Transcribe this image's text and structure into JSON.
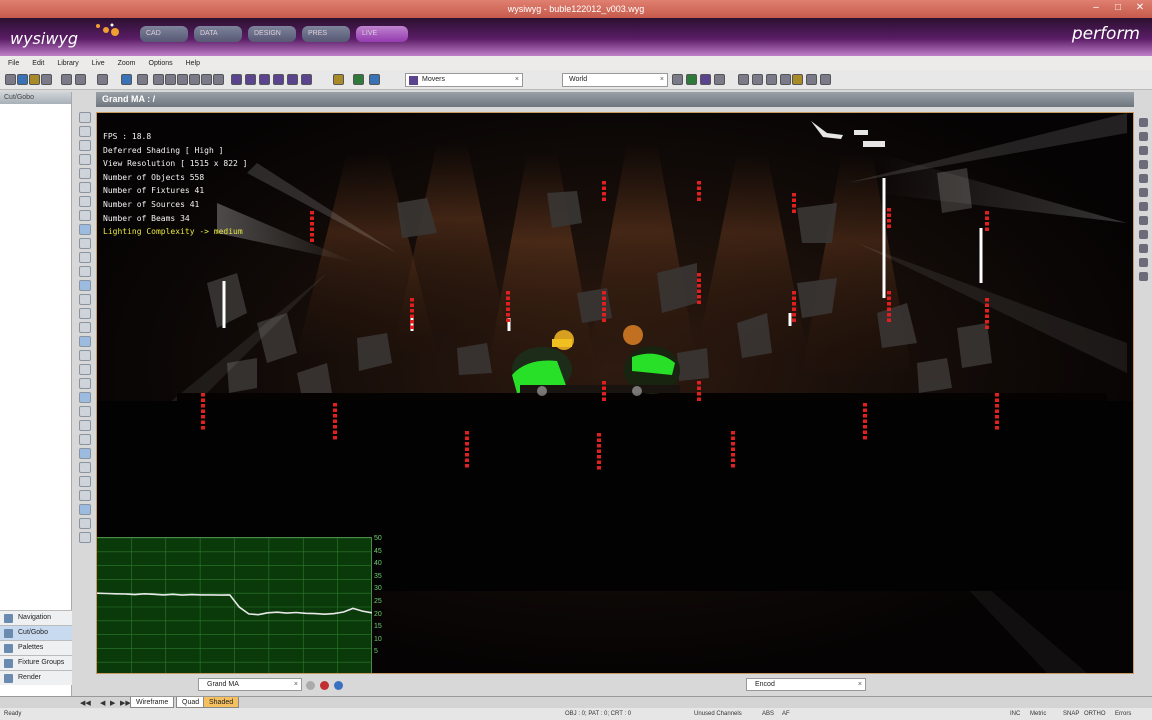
{
  "window": {
    "title": "wysiwyg - buble122012_v003.wyg"
  },
  "banner": {
    "logo": "wysiwyg",
    "mode": "perform",
    "mode_tabs": [
      "CAD",
      "DATA",
      "DESIGN",
      "PRES",
      "LIVE"
    ]
  },
  "menu": [
    "File",
    "Edit",
    "Library",
    "Live",
    "Zoom",
    "Options",
    "Help"
  ],
  "toolbar": {
    "library_combo": "Movers",
    "view_combo": "World"
  },
  "left_panel": {
    "title": "Cut/Gobo",
    "nav": [
      "Navigation",
      "Cut/Gobo",
      "Palettes",
      "Fixture Groups",
      "Render"
    ]
  },
  "viewport": {
    "title": "Grand MA : /",
    "stats": [
      "FPS : 18.8",
      "Deferred Shading [ High ]",
      "View Resolution [ 1515 x 822 ]",
      "Number of Objects 558",
      "Number of Fixtures 41",
      "Number of Sources 41",
      "Number of Beams 34"
    ],
    "complexity": "Lighting Complexity -> medium",
    "fps_graph": {
      "y_ticks": [
        "50",
        "45",
        "40",
        "35",
        "30",
        "25",
        "20",
        "15",
        "10",
        "5"
      ],
      "values": [
        30,
        29.9,
        29.8,
        29.7,
        29.5,
        29.8,
        29.6,
        29.4,
        29.6,
        29.3,
        29.5,
        29.4,
        29.4,
        29.3,
        29.4,
        25,
        22.5,
        22.2,
        22.9,
        23.1,
        22.8,
        23.0,
        22.7,
        22.6,
        22.4,
        22.6,
        23.2,
        24.5,
        23.5,
        22.9
      ]
    }
  },
  "bottom": {
    "view_combo": "Grand MA",
    "right_combo": "Encod",
    "tabs": [
      "Wireframe",
      "Quad",
      "Shaded"
    ],
    "active_tab": "Shaded"
  },
  "statusbar": {
    "left": "Ready",
    "mid": "OBJ : 0; PAT : 0; CRT : 0",
    "channels": "Unused Channels",
    "abs": "ABS",
    "af": "AF",
    "inc": "INC",
    "metric": "Metric",
    "snap": "SNAP",
    "ortho": "ORTHO",
    "errors": "Errors"
  },
  "colors": {
    "banner": "#5a1d66",
    "live_tab": "#c050d8",
    "graph_line": "#e8e8e8",
    "stats_highlight": "#e8e840"
  }
}
